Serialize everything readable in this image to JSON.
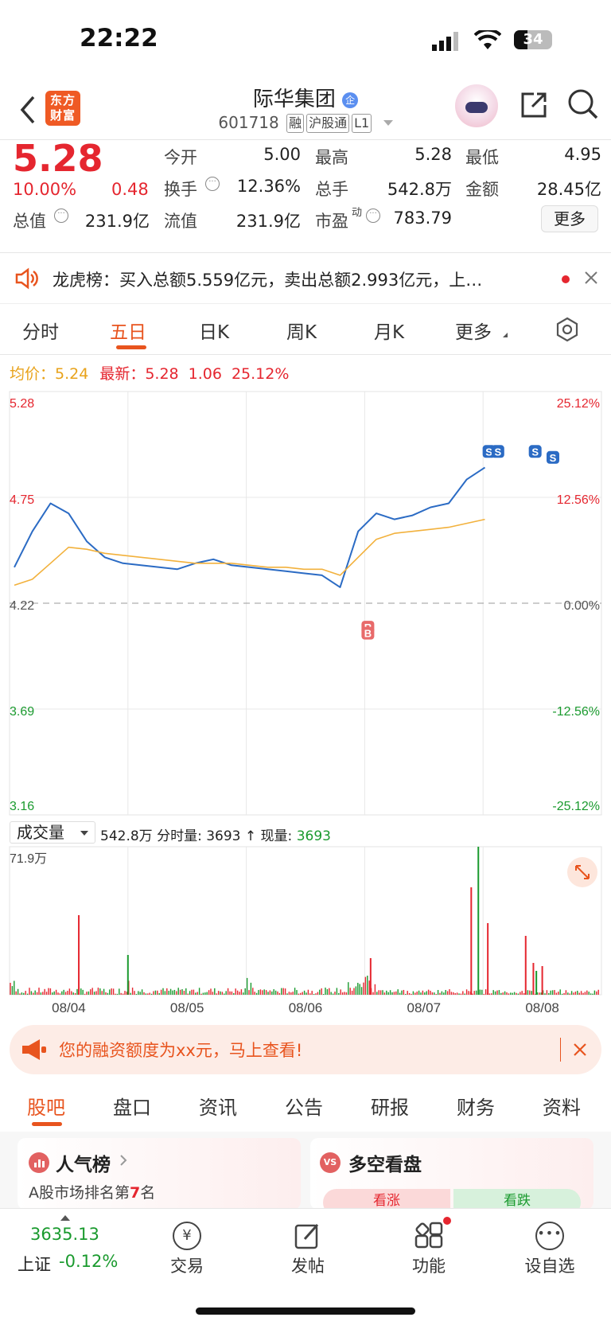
{
  "status_bar": {
    "time": "22:22",
    "battery": "34"
  },
  "header": {
    "logo_text": "东方财富",
    "stock_name": "际华集团",
    "company_badge": "企",
    "stock_code": "601718",
    "tags": [
      "融",
      "沪股通",
      "L1"
    ]
  },
  "quote": {
    "price": "5.28",
    "change_pct": "10.00%",
    "change_amt": "0.48",
    "total_value_label": "总值",
    "total_value": "231.9亿",
    "open_label": "今开",
    "open": "5.00",
    "high_label": "最高",
    "high": "5.28",
    "low_label": "最低",
    "low": "4.95",
    "turnover_label": "换手",
    "turnover": "12.36%",
    "volume_label": "总手",
    "volume": "542.8万",
    "amount_label": "金额",
    "amount": "28.45亿",
    "float_value_label": "流值",
    "float_value": "231.9亿",
    "pe_label": "市盈",
    "pe_sup": "动",
    "pe": "783.79",
    "more_button": "更多"
  },
  "banner": {
    "text": "龙虎榜：买入总额5.559亿元，卖出总额2.993亿元，上…"
  },
  "chart_tabs": [
    "分时",
    "五日",
    "日K",
    "周K",
    "月K",
    "更多"
  ],
  "chart_tabs_active": 1,
  "chart_info": {
    "avg_label": "均价：",
    "avg": "5.24",
    "latest_label": "最新：",
    "latest": "5.28",
    "change": "1.06",
    "change_pct": "25.12%"
  },
  "chart_data": {
    "type": "line",
    "x": [
      "08/04",
      "08/05",
      "08/06",
      "08/07",
      "08/08"
    ],
    "y_ticks": [
      "5.28",
      "4.75",
      "4.22",
      "3.69",
      "3.16"
    ],
    "pct_ticks": [
      "25.12%",
      "12.56%",
      "0.00%",
      "-12.56%",
      "-25.12%"
    ],
    "ylim": [
      3.16,
      5.28
    ],
    "base_price": 4.22,
    "series": [
      {
        "name": "最新",
        "color": "#2b6bc4",
        "values": [
          4.4,
          4.58,
          4.72,
          4.67,
          4.53,
          4.45,
          4.42,
          4.41,
          4.4,
          4.39,
          4.42,
          4.44,
          4.41,
          4.4,
          4.39,
          4.38,
          4.37,
          4.36,
          4.3,
          4.58,
          4.67,
          4.64,
          4.66,
          4.7,
          4.72,
          4.84,
          4.9
        ]
      },
      {
        "name": "均价",
        "color": "#f2b13c",
        "values": [
          4.31,
          4.34,
          4.42,
          4.5,
          4.49,
          4.47,
          4.46,
          4.45,
          4.44,
          4.43,
          4.42,
          4.42,
          4.42,
          4.41,
          4.4,
          4.4,
          4.39,
          4.39,
          4.36,
          4.45,
          4.54,
          4.57,
          4.58,
          4.59,
          4.6,
          4.62,
          4.64
        ]
      }
    ],
    "markers": [
      {
        "label": "R",
        "day": "08/06"
      },
      {
        "label": "B",
        "day": "08/06"
      },
      {
        "label": "S",
        "day": "08/08"
      },
      {
        "label": "S",
        "day": "08/08"
      },
      {
        "label": "S",
        "day": "08/08"
      },
      {
        "label": "S",
        "day": "08/08"
      }
    ]
  },
  "volume_header": {
    "selector": "成交量",
    "total": "542.8万",
    "tick_label": "分时量:",
    "tick_value": "3693",
    "arrow": "↑",
    "now_label": "现量:",
    "now_value": "3693",
    "max_label": "71.9万"
  },
  "promo": {
    "text": "您的融资额度为xx元，马上查看!"
  },
  "bottom_tabs": [
    "股吧",
    "盘口",
    "资讯",
    "公告",
    "研报",
    "财务",
    "资料"
  ],
  "bottom_tabs_active": 0,
  "cards": {
    "left_title": "人气榜",
    "left_sub_prefix": "A股市场排名第",
    "left_rank": "7",
    "left_sub_suffix": "名",
    "right_badge": "VS",
    "right_title": "多空看盘",
    "bull": "看涨",
    "bear": "看跌"
  },
  "bottom_bar": {
    "index_value": "3635.13",
    "index_name": "上证",
    "index_change": "-0.12%",
    "items": [
      "交易",
      "发帖",
      "功能",
      "设自选"
    ]
  },
  "colors": {
    "up": "#e5262f",
    "down": "#1a9a2e",
    "accent": "#e8541e",
    "price_line": "#2b6bc4",
    "avg_line": "#f2b13c"
  }
}
